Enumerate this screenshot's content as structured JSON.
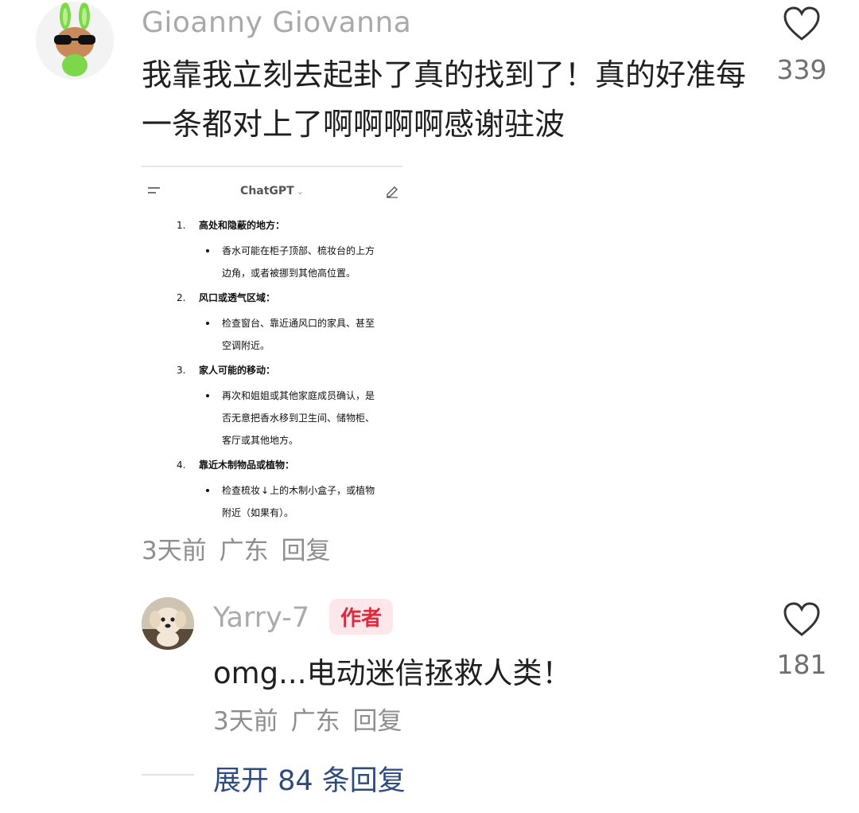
{
  "comment": {
    "author": "Gioanny Giovanna",
    "text": "我靠我立刻去起卦了真的找到了！真的好准每一条都对上了啊啊啊啊感谢驻波",
    "likes": "339",
    "time": "3天前",
    "location": "广东",
    "reply_label": "回复",
    "avatar_icon": "bunny-sunglasses-avatar",
    "screenshot": {
      "app_title": "ChatGPT",
      "caret": "⌄",
      "menu_icon": "menu-icon",
      "edit_icon": "edit-icon",
      "items": [
        {
          "num": "1.",
          "heading": "高处和隐蔽的地方：",
          "lines": [
            "香水可能在柜子顶部、梳妆台的上方",
            "边角，或者被挪到其他高位置。"
          ]
        },
        {
          "num": "2.",
          "heading": "风口或透气区域：",
          "lines": [
            "检查窗台、靠近通风口的家具、甚至",
            "空调附近。"
          ]
        },
        {
          "num": "3.",
          "heading": "家人可能的移动：",
          "lines": [
            "再次和姐姐或其他家庭成员确认，是",
            "否无意把香水移到卫生间、储物柜、",
            "客厅或其他地方。"
          ]
        },
        {
          "num": "4.",
          "heading": "靠近木制物品或植物：",
          "lines": [
            "检查梳妆台上的木制小盒子，或植物",
            "附近（如果有）。"
          ]
        }
      ],
      "line4a_left": "检查梳妆",
      "line4a_right": "上的木制小盒子，或植物",
      "scroll_icon": "↓"
    }
  },
  "reply": {
    "author": "Yarry-7",
    "badge": "作者",
    "text": "omg...电动迷信拯救人类！",
    "likes": "181",
    "time": "3天前",
    "location": "广东",
    "reply_label": "回复",
    "avatar_icon": "dog-avatar"
  },
  "expand": {
    "label": "展开 84 条回复"
  },
  "colors": {
    "name": "#a9a9a9",
    "text": "#1f1f1f",
    "meta": "#8e8e8e",
    "badge_bg": "#fde7ea",
    "badge_text": "#e0293f",
    "link": "#2d4b7f"
  }
}
